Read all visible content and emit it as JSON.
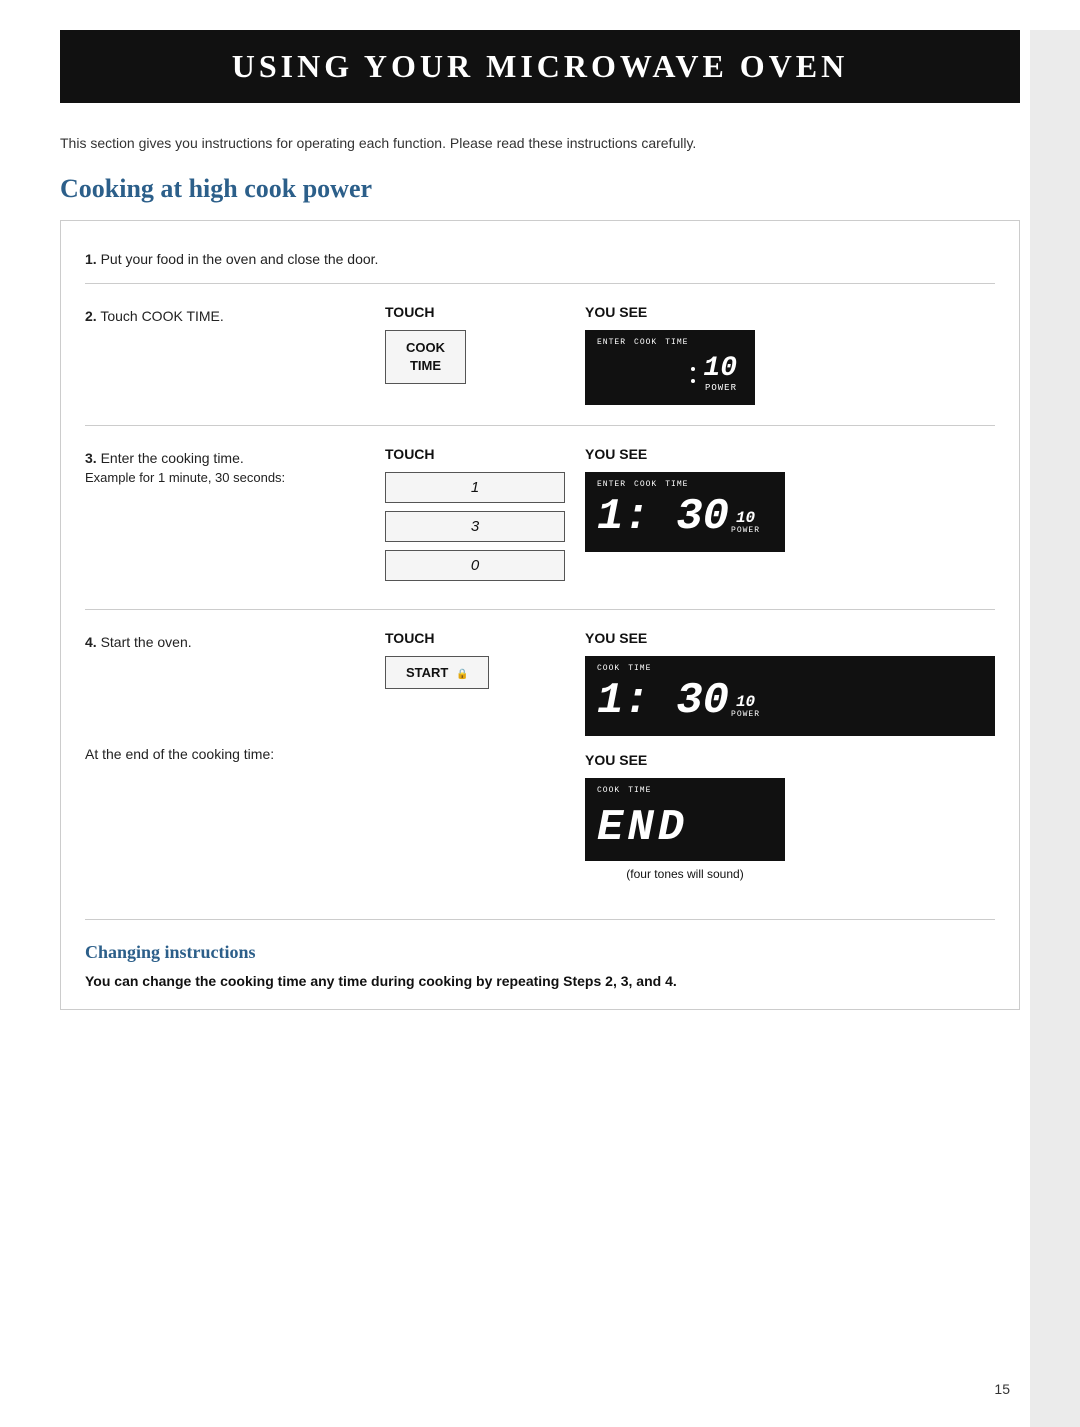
{
  "header": {
    "title": "Using Your Microwave Oven"
  },
  "intro": "This section gives you instructions for operating each function. Please read these instructions carefully.",
  "section_title": "Cooking at high cook power",
  "step1": {
    "text": "Put your food in the oven and close the door.",
    "number": "1."
  },
  "step2": {
    "number": "2.",
    "desc": "Touch COOK TIME.",
    "touch_label": "TOUCH",
    "yousee_label": "YOU SEE",
    "button": "COOK\nTIME",
    "display_top": "ENTER  COOK  TIME",
    "display_power_num": "10",
    "display_power_label": "POWER"
  },
  "step3": {
    "number": "3.",
    "desc": "Enter the cooking time.",
    "sub_desc": "Example for 1 minute, 30 seconds:",
    "touch_label": "TOUCH",
    "yousee_label": "YOU SEE",
    "buttons": [
      "1",
      "3",
      "0"
    ],
    "display_top": "ENTER  COOK  TIME",
    "display_time": "1: 30",
    "display_power_num": "10",
    "display_power_label": "POWER"
  },
  "step4": {
    "number": "4.",
    "desc": "Start the oven.",
    "touch_label": "TOUCH",
    "yousee_label": "YOU SEE",
    "yousee_label2": "YOU SEE",
    "button": "START",
    "display1_top": "COOK  TIME",
    "display1_time": "1: 30",
    "display1_power_num": "10",
    "display1_power_label": "POWER",
    "end_desc": "At the end of the cooking time:",
    "display2_top": "COOK  TIME",
    "display2_text": "END",
    "four_tones": "(four tones will sound)"
  },
  "sub_section": {
    "title": "Changing instructions",
    "text": "You can change the cooking time any time during cooking by repeating Steps 2, 3, and 4."
  },
  "page_number": "15"
}
